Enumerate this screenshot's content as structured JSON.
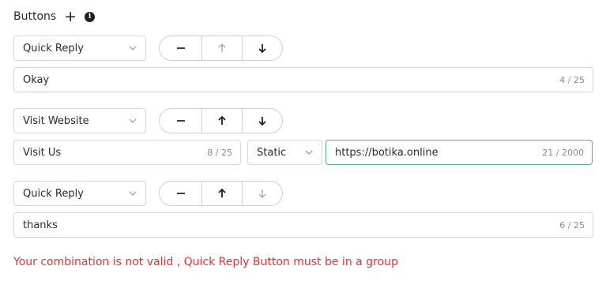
{
  "header": {
    "title": "Buttons",
    "add_icon": "plus-icon",
    "info_icon": "info-icon",
    "info_glyph": "i"
  },
  "buttons": [
    {
      "type": "Quick Reply",
      "text_value": "Okay",
      "text_counter": "4 / 25",
      "controls": {
        "remove": "enabled",
        "move_up": "disabled",
        "move_down": "enabled"
      }
    },
    {
      "type": "Visit Website",
      "text_value": "Visit Us",
      "text_counter": "8 / 25",
      "url_type": "Static",
      "url_value": "https://botika.online",
      "url_counter": "21 / 2000",
      "controls": {
        "remove": "enabled",
        "move_up": "enabled",
        "move_down": "enabled"
      }
    },
    {
      "type": "Quick Reply",
      "text_value": "thanks",
      "text_counter": "6 / 25",
      "controls": {
        "remove": "enabled",
        "move_up": "enabled",
        "move_down": "disabled"
      }
    }
  ],
  "error_message": "Your combination is not valid , Quick Reply Button must be in a group",
  "colors": {
    "error": "#d93737",
    "focus_border": "#58a9a1",
    "icon_enabled": "#222222",
    "icon_disabled": "#b0b0b0"
  },
  "icons": [
    "minus-icon",
    "arrow-up-icon",
    "arrow-down-icon",
    "chevron-down-icon"
  ]
}
